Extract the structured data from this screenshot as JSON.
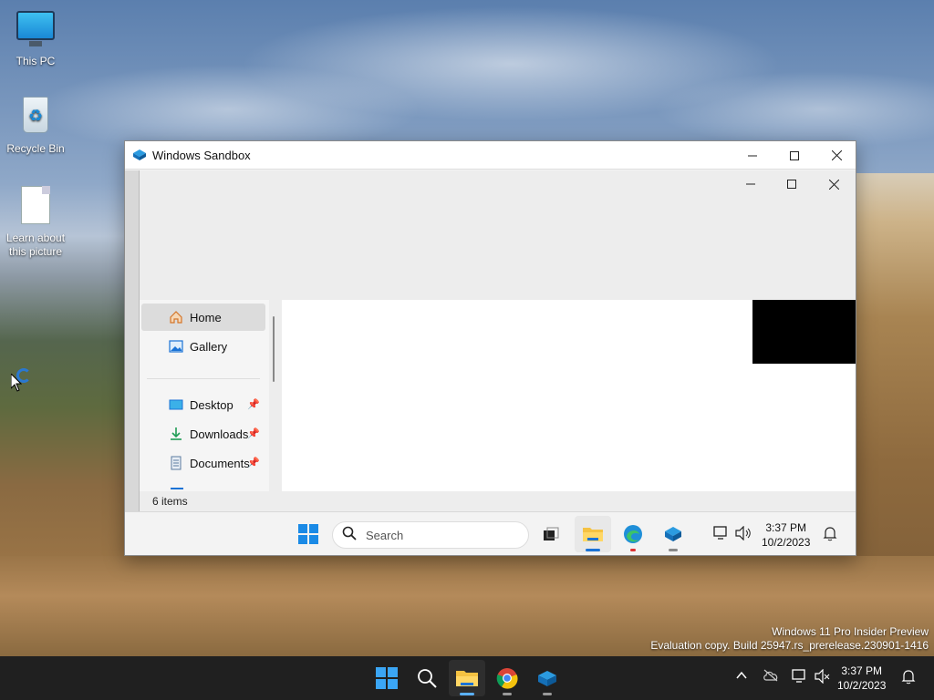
{
  "desktop": {
    "icons": [
      {
        "label": "This PC"
      },
      {
        "label": "Recycle Bin"
      },
      {
        "label": "Learn about this picture"
      }
    ],
    "watermark": {
      "line1": "Windows 11 Pro Insider Preview",
      "line2": "Evaluation copy. Build 25947.rs_prerelease.230901-1416"
    }
  },
  "sandbox_window": {
    "title": "Windows Sandbox",
    "explorer": {
      "nav_items": [
        {
          "label": "Home",
          "icon": "home-icon",
          "selected": true
        },
        {
          "label": "Gallery",
          "icon": "gallery-icon"
        },
        {
          "label": "Desktop",
          "icon": "desktop-folder-icon",
          "pinned": true
        },
        {
          "label": "Downloads",
          "icon": "downloads-icon",
          "pinned": true
        },
        {
          "label": "Documents",
          "icon": "documents-icon",
          "pinned": true
        }
      ],
      "status": "6 items"
    },
    "taskbar": {
      "search_placeholder": "Search",
      "time": "3:37 PM",
      "date": "10/2/2023"
    }
  },
  "taskbar": {
    "time": "3:37 PM",
    "date": "10/2/2023"
  },
  "colors": {
    "accent": "#1a73d6",
    "taskbar_bg": "#202020",
    "window_bg": "#f3f3f3"
  }
}
